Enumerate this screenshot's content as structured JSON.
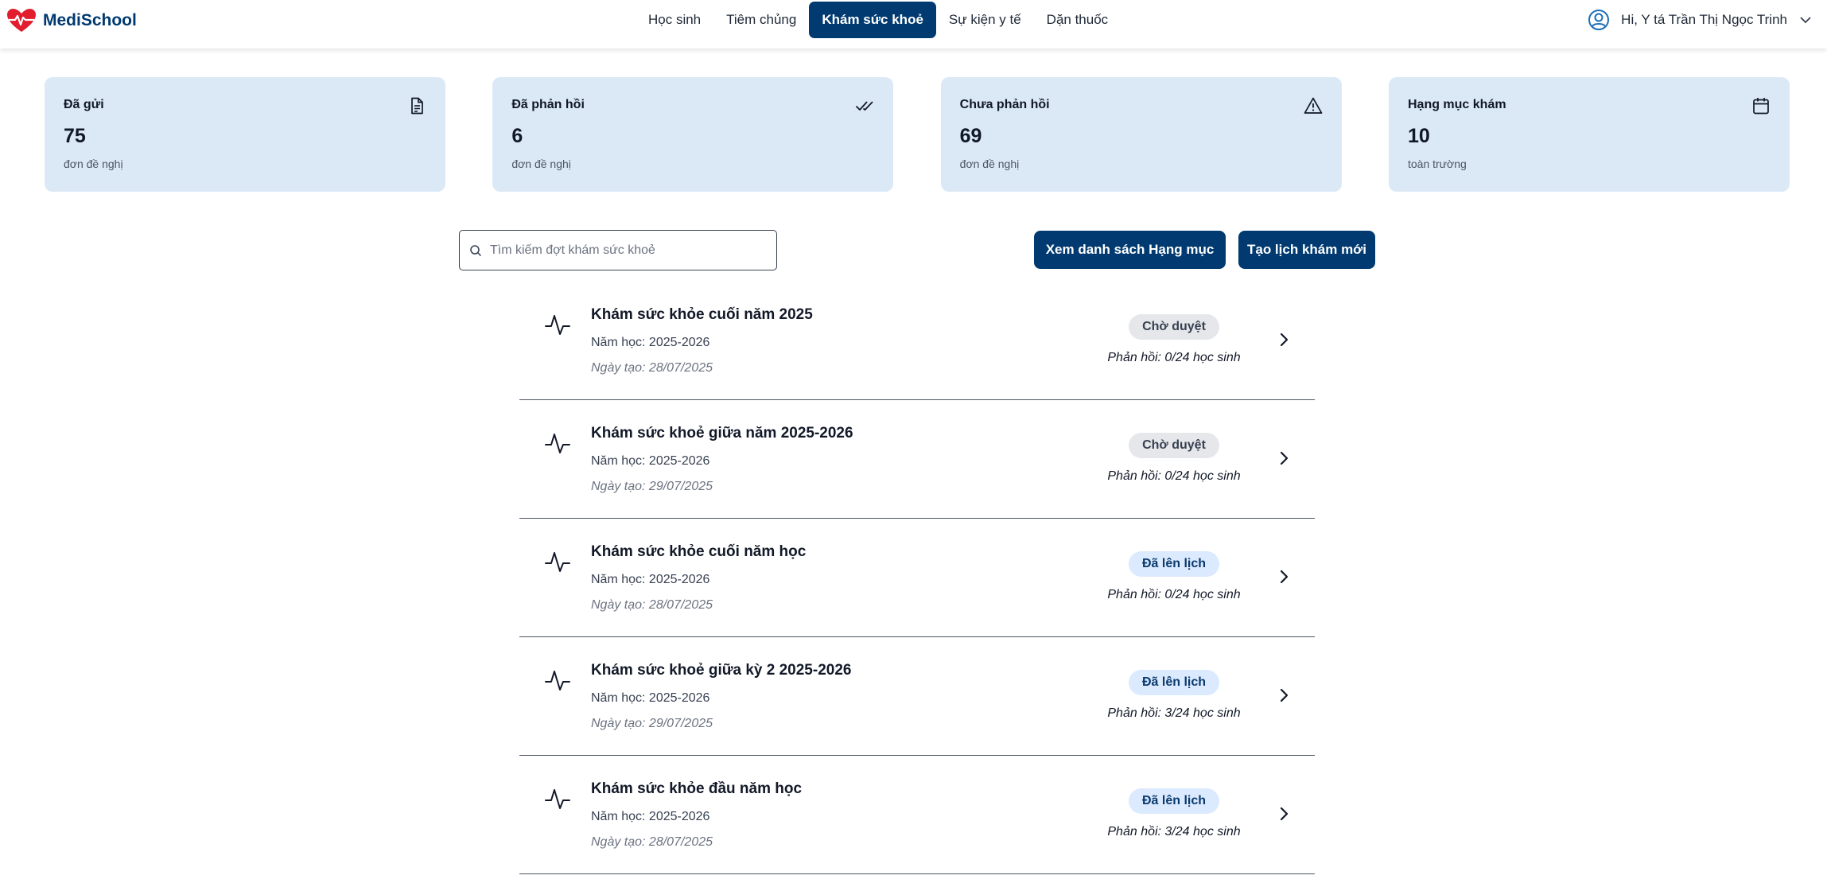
{
  "brand": {
    "name": "MediSchool",
    "accent": "#003a70",
    "logo_icon": "heart-pulse-icon"
  },
  "nav": {
    "items": [
      {
        "label": "Học sinh",
        "active": false
      },
      {
        "label": "Tiêm chủng",
        "active": false
      },
      {
        "label": "Khám sức khoẻ",
        "active": true
      },
      {
        "label": "Sự kiện y tế",
        "active": false
      },
      {
        "label": "Dặn thuốc",
        "active": false
      }
    ]
  },
  "user": {
    "greeting": "Hi, Y tá Trần Thị Ngọc Trinh",
    "icon": "user-circle-icon"
  },
  "stats": [
    {
      "title": "Đã gửi",
      "value": "75",
      "sub": "đơn đề nghị",
      "icon": "document-icon"
    },
    {
      "title": "Đã phản hồi",
      "value": "6",
      "sub": "đơn đề nghị",
      "icon": "double-check-icon"
    },
    {
      "title": "Chưa phản hồi",
      "value": "69",
      "sub": "đơn đề nghị",
      "icon": "warning-icon"
    },
    {
      "title": "Hạng mục khám",
      "value": "10",
      "sub": "toàn trường",
      "icon": "calendar-icon"
    }
  ],
  "search": {
    "placeholder": "Tìm kiếm đợt khám sức khoẻ",
    "value": ""
  },
  "actions": {
    "list_label": "Xem danh sách Hạng mục",
    "create_label": "Tạo lịch khám mới"
  },
  "checkups": [
    {
      "title": "Khám sức khỏe cuối năm 2025",
      "year": "Năm học: 2025-2026",
      "created": "Ngày tạo: 28/07/2025",
      "status": "Chờ duyệt",
      "status_type": "pending",
      "response": "Phản hồi: 0/24 học sinh"
    },
    {
      "title": "Khám sức khoẻ giữa năm 2025-2026",
      "year": "Năm học: 2025-2026",
      "created": "Ngày tạo: 29/07/2025",
      "status": "Chờ duyệt",
      "status_type": "pending",
      "response": "Phản hồi: 0/24 học sinh"
    },
    {
      "title": "Khám sức khỏe cuối năm học",
      "year": "Năm học: 2025-2026",
      "created": "Ngày tạo: 28/07/2025",
      "status": "Đã lên lịch",
      "status_type": "scheduled",
      "response": "Phản hồi: 0/24 học sinh"
    },
    {
      "title": "Khám sức khoẻ giữa kỳ 2 2025-2026",
      "year": "Năm học: 2025-2026",
      "created": "Ngày tạo: 29/07/2025",
      "status": "Đã lên lịch",
      "status_type": "scheduled",
      "response": "Phản hồi: 3/24 học sinh"
    },
    {
      "title": "Khám sức khỏe đầu năm học",
      "year": "Năm học: 2025-2026",
      "created": "Ngày tạo: 28/07/2025",
      "status": "Đã lên lịch",
      "status_type": "scheduled",
      "response": "Phản hồi: 3/24 học sinh"
    }
  ]
}
